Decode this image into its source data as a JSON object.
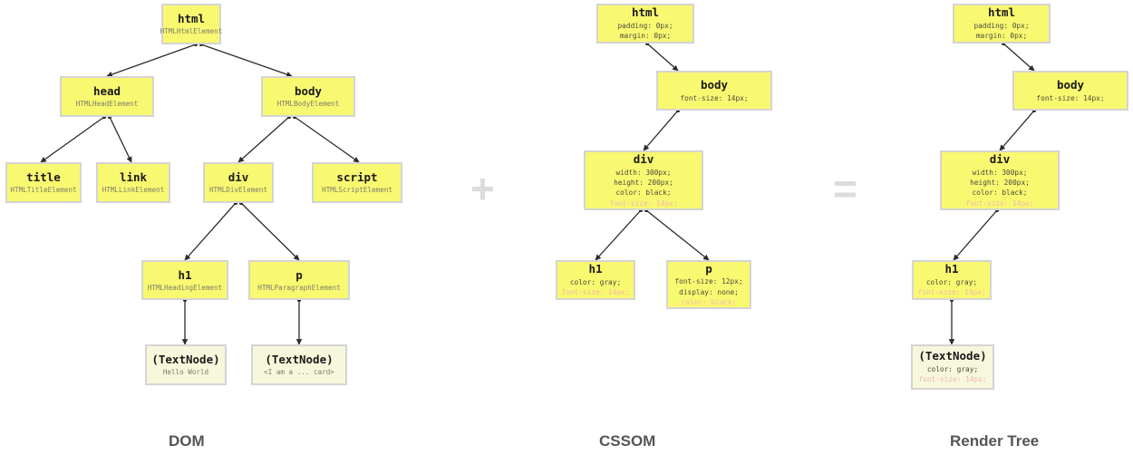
{
  "colors": {
    "node_fill": "#f9f871",
    "textnode_fill": "#f7f7dc",
    "node_border": "#d4d4d4",
    "operator": "#dcdcdc",
    "caption": "#555555",
    "inherited_prop": "#f0b9ad"
  },
  "operators": {
    "plus": "+",
    "equals": "="
  },
  "captions": {
    "dom": "DOM",
    "cssom": "CSSOM",
    "render_tree": "Render Tree"
  },
  "dom": {
    "nodes": {
      "html": {
        "title": "html",
        "sub": "HTMLHtmlElement"
      },
      "head": {
        "title": "head",
        "sub": "HTMLHeadElement"
      },
      "body": {
        "title": "body",
        "sub": "HTMLBodyElement"
      },
      "title": {
        "title": "title",
        "sub": "HTMLTitleElement"
      },
      "link": {
        "title": "link",
        "sub": "HTMLLinkElement"
      },
      "div": {
        "title": "div",
        "sub": "HTMLDivElement"
      },
      "script": {
        "title": "script",
        "sub": "HTMLScriptElement"
      },
      "h1": {
        "title": "h1",
        "sub": "HTMLHeadingElement"
      },
      "p": {
        "title": "p",
        "sub": "HTMLParagraphElement"
      },
      "h1_text": {
        "title": "(TextNode)",
        "sub": "Hello World"
      },
      "p_text": {
        "title": "(TextNode)",
        "sub": "<I am a ... card>"
      }
    }
  },
  "cssom": {
    "nodes": {
      "html": {
        "title": "html",
        "props": [
          "padding: 0px;",
          "margin: 0px;"
        ],
        "inherited": []
      },
      "body": {
        "title": "body",
        "props": [
          "font-size: 14px;"
        ],
        "inherited": []
      },
      "div": {
        "title": "div",
        "props": [
          "width: 300px;",
          "height: 200px;",
          "color: black;"
        ],
        "inherited": [
          "font-size: 14px;"
        ]
      },
      "h1": {
        "title": "h1",
        "props": [
          "color: gray;"
        ],
        "inherited": [
          "font-size: 14px;"
        ]
      },
      "p": {
        "title": "p",
        "props": [
          "font-size: 12px;",
          "display: none;"
        ],
        "inherited": [
          "color: black;"
        ]
      }
    }
  },
  "render_tree": {
    "nodes": {
      "html": {
        "title": "html",
        "props": [
          "padding: 0px;",
          "margin: 0px;"
        ],
        "inherited": []
      },
      "body": {
        "title": "body",
        "props": [
          "font-size: 14px;"
        ],
        "inherited": []
      },
      "div": {
        "title": "div",
        "props": [
          "width: 300px;",
          "height: 200px;",
          "color: black;"
        ],
        "inherited": [
          "font-size: 14px;"
        ]
      },
      "h1": {
        "title": "h1",
        "props": [
          "color: gray;"
        ],
        "inherited": [
          "font-size: 14px;"
        ]
      },
      "h1_text": {
        "title": "(TextNode)",
        "props": [
          "color: gray;"
        ],
        "inherited": [
          "font-size: 14px;"
        ]
      }
    }
  }
}
